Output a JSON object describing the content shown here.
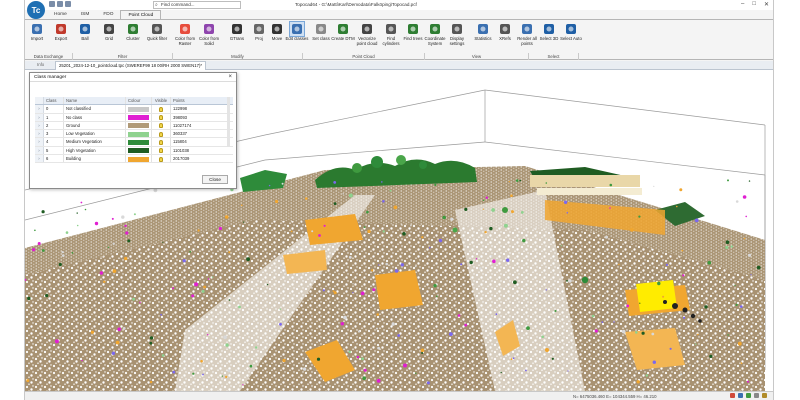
{
  "app": {
    "logo_text": "Tc",
    "window_title": "Topocad64 - G:\\Matti\\Karl\\Demodata\\Falköping\\Topocad.pcf",
    "command_search_placeholder": "Find command...",
    "window_controls": [
      "–",
      "□",
      "✕"
    ]
  },
  "ribbon": {
    "tabs": [
      {
        "label": "Home",
        "active": false
      },
      {
        "label": "ISM",
        "active": false
      },
      {
        "label": "FDO",
        "active": false
      },
      {
        "label": "Point Cloud",
        "active": true
      }
    ],
    "buttons": [
      {
        "label": "Import",
        "icon": "import-icon",
        "color": "#3a6fb0",
        "selected": false
      },
      {
        "label": "Export",
        "icon": "export-icon",
        "color": "#c0392b",
        "selected": false
      },
      {
        "label": "Ball",
        "icon": "ball-icon",
        "color": "#1f5fa5",
        "selected": false
      },
      {
        "label": "Grid",
        "icon": "grid-icon",
        "color": "#444444",
        "selected": false
      },
      {
        "label": "Cluster",
        "icon": "cluster-icon",
        "color": "#2e7d32",
        "selected": false
      },
      {
        "label": "Quick filter",
        "icon": "quick-filter-icon",
        "color": "#555555",
        "selected": false
      },
      {
        "label": "Color from Raster",
        "icon": "color-raster-icon",
        "color": "#e74c3c",
        "selected": false
      },
      {
        "label": "Color from Solid",
        "icon": "color-solid-icon",
        "color": "#8e44ad",
        "selected": false
      },
      {
        "label": "GTrans",
        "icon": "gtrans-icon",
        "color": "#333333",
        "selected": false
      },
      {
        "label": "Proj",
        "icon": "proj-icon",
        "color": "#666666",
        "selected": false
      },
      {
        "label": "Move",
        "icon": "move-icon",
        "color": "#333333",
        "selected": false
      },
      {
        "label": "Edit classes",
        "icon": "edit-classes-icon",
        "color": "#3a6fb0",
        "selected": true
      },
      {
        "label": "Set class",
        "icon": "set-class-icon",
        "color": "#888888",
        "selected": false
      },
      {
        "label": "Create DTM",
        "icon": "create-dtm-icon",
        "color": "#2e7d32",
        "selected": false
      },
      {
        "label": "Vectorize point cloud",
        "icon": "vectorize-icon",
        "color": "#444444",
        "selected": false
      },
      {
        "label": "Find cylinders",
        "icon": "find-cylinders-icon",
        "color": "#555555",
        "selected": false
      },
      {
        "label": "Find trees",
        "icon": "find-trees-icon",
        "color": "#2e7d32",
        "selected": false
      },
      {
        "label": "Coordinate System",
        "icon": "coordinate-system-icon",
        "color": "#2e7d32",
        "selected": false
      },
      {
        "label": "Display settings",
        "icon": "display-settings-icon",
        "color": "#555555",
        "selected": false
      },
      {
        "label": "Statistics",
        "icon": "statistics-icon",
        "color": "#3a6fb0",
        "selected": false
      },
      {
        "label": "XRefs",
        "icon": "xrefs-icon",
        "color": "#555555",
        "selected": false
      },
      {
        "label": "Render all points",
        "icon": "render-points-icon",
        "color": "#3a6fb0",
        "selected": false
      },
      {
        "label": "Select 3D",
        "icon": "select-3d-icon",
        "color": "#1f5fa5",
        "selected": false
      },
      {
        "label": "Select Auto",
        "icon": "select-auto-icon",
        "color": "#1f5fa5",
        "selected": false
      }
    ],
    "groups": [
      "Data Exchange",
      "Filter",
      "Modify",
      "Point Cloud",
      "View",
      "Select"
    ]
  },
  "document": {
    "stub_tab": "Info",
    "tab_title": "25201_2024-12-10_pointcloud.tpc (SWEREF99 18 00/RH 2000 SWEN17)*"
  },
  "dialog": {
    "title": "Class manager",
    "columns": {
      "class": "Class",
      "name": "Name",
      "colour": "Colour",
      "visible": "Visible",
      "points": "Points"
    },
    "rows": [
      {
        "class": "0",
        "name": "Not classified",
        "colour": "#c8c8c8",
        "points": "122998"
      },
      {
        "class": "1",
        "name": "No class",
        "colour": "#e01fd2",
        "points": "398093"
      },
      {
        "class": "2",
        "name": "Ground",
        "colour": "#b09a78",
        "points": "11027174"
      },
      {
        "class": "3",
        "name": "Low Vegetation",
        "colour": "#8fd28f",
        "points": "360337"
      },
      {
        "class": "4",
        "name": "Medium Vegetation",
        "colour": "#2e8b3a",
        "points": "115804"
      },
      {
        "class": "5",
        "name": "High Vegetation",
        "colour": "#1f5c22",
        "points": "1101038"
      },
      {
        "class": "6",
        "name": "Building",
        "colour": "#f0a630",
        "points": "2017039"
      }
    ],
    "close_label": "Close"
  },
  "status": {
    "coords": "N= 6475036.460 E= 104344.559 H= 46.210"
  }
}
